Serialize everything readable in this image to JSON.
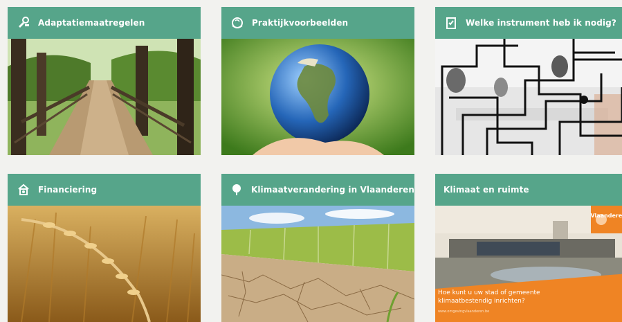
{
  "tiles": [
    {
      "title": "Adaptatiemaatregelen",
      "icon": "tools-icon"
    },
    {
      "title": "Praktijkvoorbeelden",
      "icon": "globe-icon"
    },
    {
      "title": "Welke instrument heb ik nodig?",
      "icon": "checklist-icon"
    },
    {
      "title": "Financiering",
      "icon": "money-icon"
    },
    {
      "title": "Klimaatverandering in Vlaanderen",
      "icon": "tree-icon"
    },
    {
      "title": "Klimaat en ruimte",
      "icon": null
    }
  ],
  "brochure": {
    "text": "Hoe kunt u uw stad of gemeente klimaatbestendig inrichten?",
    "brand": "Vlaanderen",
    "url": "www.omgevingvlaanderen.be"
  },
  "colors": {
    "header": "#56a58a",
    "brochure_orange": "#ef8424"
  }
}
